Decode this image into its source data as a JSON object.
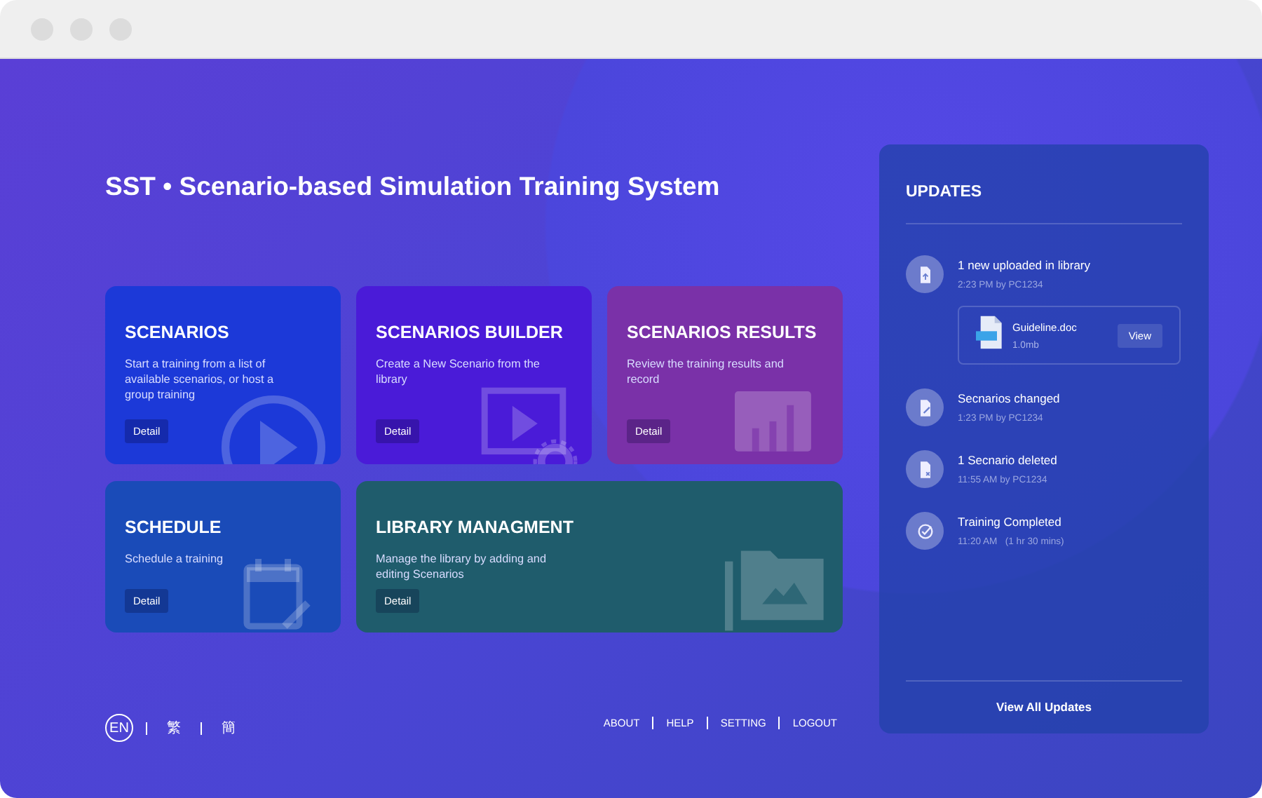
{
  "title": "SST • Scenario-based Simulation Training System",
  "cards": [
    {
      "kind": "play",
      "title": "SCENARIOS",
      "text": "Start a training from a list of available scenarios, or host a group training",
      "button": "Detail",
      "color": "#1c39d8"
    },
    {
      "kind": "builder",
      "title": "SCENARIOS BUILDER",
      "text": "Create a New Scenario from the library",
      "button": "Detail",
      "color": "#4a1bd8"
    },
    {
      "kind": "results",
      "title": "SCENARIOS RESULTS",
      "text": "Review the training results and record",
      "button": "Detail",
      "color": "#7a31a8"
    },
    {
      "kind": "calendar",
      "title": "SCHEDULE",
      "text": "Schedule a training",
      "button": "Detail",
      "color": "#1a4bb8"
    },
    {
      "kind": "folder",
      "title": "LIBRARY MANAGMENT",
      "text": "Manage the library by adding and editing Scenarios",
      "button": "Detail",
      "color": "#1f5c6c"
    }
  ],
  "languages": [
    {
      "label": "EN",
      "selected": true
    },
    {
      "label": "繁",
      "selected": false
    },
    {
      "label": "簡",
      "selected": false
    }
  ],
  "footer_links": [
    "ABOUT",
    "HELP",
    "SETTING",
    "LOGOUT"
  ],
  "updates": {
    "title": "UPDATES",
    "items": [
      {
        "kind": "upload",
        "title": "1 new uploaded in library",
        "meta": "2:23 PM by PC1234",
        "attachment": {
          "name": "Guideline.doc",
          "size": "1.0mb",
          "button": "View"
        }
      },
      {
        "kind": "edit",
        "title": "Secnarios changed",
        "meta": "1:23 PM by PC1234"
      },
      {
        "kind": "delete",
        "title": "1 Secnario deleted",
        "meta": "11:55 AM by PC1234"
      },
      {
        "kind": "check",
        "title": "Training Completed",
        "meta": "11:20 AM   (1 hr 30 mins)"
      }
    ],
    "view_all": "View All Updates"
  }
}
